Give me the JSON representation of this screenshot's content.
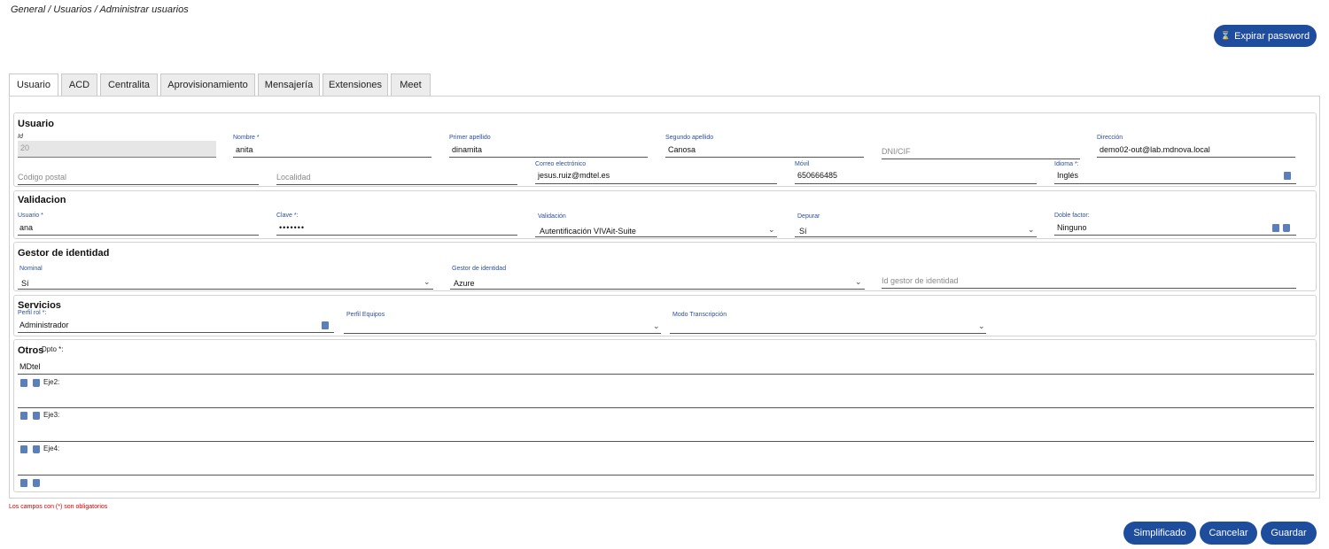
{
  "breadcrumb": "General / Usuarios / Administrar usuarios",
  "expire_button": "Expirar password",
  "tabs": [
    "Usuario",
    "ACD",
    "Centralita",
    "Aprovisionamiento",
    "Mensajería",
    "Extensiones",
    "Meet"
  ],
  "usuario": {
    "title": "Usuario",
    "id_label": "Id",
    "id_value": "20",
    "nombre_label": "Nombre *",
    "nombre_value": "anita",
    "apellido1_label": "Primer apellido",
    "apellido1_value": "dinamita",
    "apellido2_label": "Segundo apellido",
    "apellido2_value": "Canosa",
    "dni_placeholder": "DNI/CIF",
    "direccion_label": "Dirección",
    "direccion_value": "demo02-out@lab.mdnova.local",
    "cp_placeholder": "Código postal",
    "localidad_placeholder": "Localidad",
    "correo_label": "Correo electrónico",
    "correo_value": "jesus.ruiz@mdtel.es",
    "movil_label": "Móvil",
    "movil_value": "650666485",
    "idioma_label": "Idioma *:",
    "idioma_value": "Inglés"
  },
  "validacion": {
    "title": "Validacion",
    "usuario_label": "Usuario *",
    "usuario_value": "ana",
    "clave_label": "Clave *:",
    "clave_value": "•••••••",
    "validacion_label": "Validación",
    "validacion_value": "Autentificación VIVAit-Suite",
    "depurar_label": "Depurar",
    "depurar_value": "Sí",
    "doble_label": "Doble factor:",
    "doble_value": "Ninguno"
  },
  "gestor": {
    "title": "Gestor de identidad",
    "nominal_label": "Nominal",
    "nominal_value": "Sí",
    "gestor_label": "Gestor de identidad",
    "gestor_value": "Azure",
    "id_placeholder": "Id gestor de identidad"
  },
  "servicios": {
    "title": "Servicios",
    "perfil_label": "Perfil rol *:",
    "perfil_value": "Administrador",
    "equipos_label": "Perfil Equipos",
    "modo_label": "Modo Transcripción"
  },
  "otros": {
    "title": "Otros",
    "dpto_label": "Dpto *:",
    "dpto_value": "MDtel",
    "eje2_label": "Eje2:",
    "eje3_label": "Eje3:",
    "eje4_label": "Eje4:"
  },
  "required_note": "Los campos con (*) son obligatorios",
  "footer": {
    "simplificado": "Simplificado",
    "cancelar": "Cancelar",
    "guardar": "Guardar"
  },
  "colors": {
    "primary": "#1f4d9e",
    "label": "#2b4f9d",
    "required": "#d40000"
  }
}
